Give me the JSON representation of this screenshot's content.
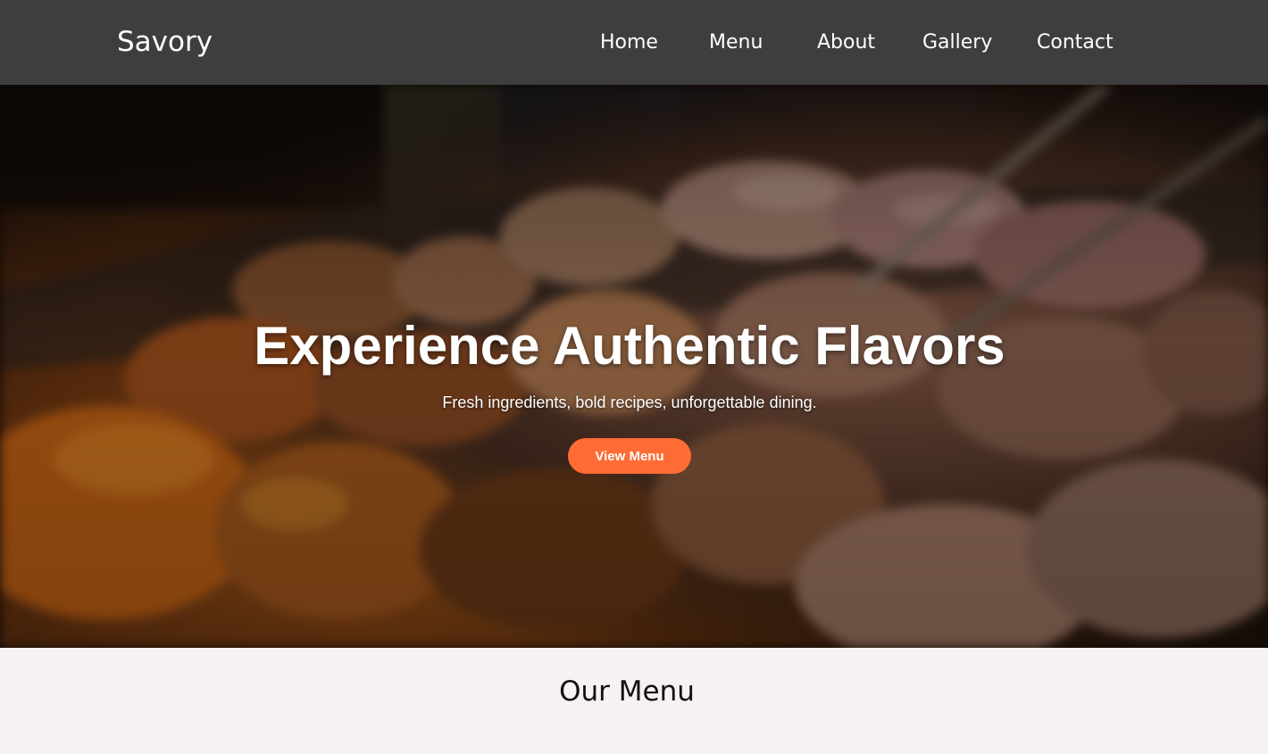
{
  "header": {
    "brand": "Savory",
    "nav": {
      "home": "Home",
      "menu": "Menu",
      "about": "About",
      "gallery": "Gallery",
      "contact": "Contact"
    }
  },
  "hero": {
    "image": "grilled-meat-photo",
    "title": "Experience Authentic Flavors",
    "subtitle": "Fresh ingredients, bold recipes, unforgettable dining.",
    "button_label": "View Menu"
  },
  "menu_section": {
    "heading": "Our Menu"
  },
  "colors": {
    "navbar": "#3f3e3f",
    "accent": "#ff6b35",
    "section_bg": "#f7f1f1",
    "text_light": "#ffffff",
    "text_dark": "#111111"
  }
}
